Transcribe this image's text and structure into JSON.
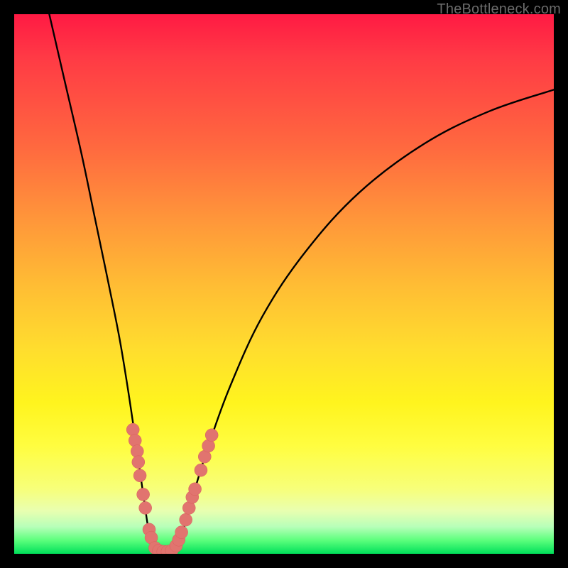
{
  "watermark": "TheBottleneck.com",
  "colors": {
    "background": "#000000",
    "marker_fill": "#e1746f",
    "marker_stroke": "#d85f5a",
    "curve": "#000000"
  },
  "chart_data": {
    "type": "line",
    "title": "",
    "xlabel": "",
    "ylabel": "",
    "xlim": [
      0,
      100
    ],
    "ylim": [
      0,
      100
    ],
    "grid": false,
    "legend": false,
    "curve_left": {
      "description": "left branch of V-shaped bottleneck curve",
      "points": [
        {
          "x": 6.5,
          "y": 100
        },
        {
          "x": 9.5,
          "y": 87
        },
        {
          "x": 12.5,
          "y": 74
        },
        {
          "x": 15,
          "y": 62
        },
        {
          "x": 17.5,
          "y": 50
        },
        {
          "x": 19.5,
          "y": 40
        },
        {
          "x": 21,
          "y": 31
        },
        {
          "x": 22.2,
          "y": 23
        },
        {
          "x": 23.2,
          "y": 16
        },
        {
          "x": 24.2,
          "y": 9
        },
        {
          "x": 25,
          "y": 4
        },
        {
          "x": 26,
          "y": 1.2
        },
        {
          "x": 27,
          "y": 0.4
        }
      ]
    },
    "curve_right": {
      "description": "right branch of V-shaped bottleneck curve",
      "points": [
        {
          "x": 29,
          "y": 0.4
        },
        {
          "x": 30,
          "y": 1.5
        },
        {
          "x": 31.5,
          "y": 5
        },
        {
          "x": 33.5,
          "y": 12
        },
        {
          "x": 36,
          "y": 20
        },
        {
          "x": 40,
          "y": 31
        },
        {
          "x": 46,
          "y": 44
        },
        {
          "x": 54,
          "y": 56
        },
        {
          "x": 64,
          "y": 67
        },
        {
          "x": 76,
          "y": 76
        },
        {
          "x": 88,
          "y": 82
        },
        {
          "x": 100,
          "y": 86
        }
      ]
    },
    "curve_bottom": {
      "description": "flat bottom of V curve",
      "points": [
        {
          "x": 27,
          "y": 0.4
        },
        {
          "x": 29,
          "y": 0.4
        }
      ]
    },
    "markers_left": {
      "description": "pink cluster markers on left branch",
      "points": [
        {
          "x": 22.0,
          "y": 23.0
        },
        {
          "x": 22.4,
          "y": 21.0
        },
        {
          "x": 22.8,
          "y": 19.0
        },
        {
          "x": 23.0,
          "y": 17.0
        },
        {
          "x": 23.3,
          "y": 14.5
        },
        {
          "x": 23.9,
          "y": 11.0
        },
        {
          "x": 24.3,
          "y": 8.5
        },
        {
          "x": 25.0,
          "y": 4.5
        },
        {
          "x": 25.4,
          "y": 3.0
        },
        {
          "x": 26.1,
          "y": 1.1
        },
        {
          "x": 26.8,
          "y": 0.6
        },
        {
          "x": 27.6,
          "y": 0.4
        }
      ]
    },
    "markers_right": {
      "description": "pink cluster markers on right branch",
      "points": [
        {
          "x": 28.4,
          "y": 0.4
        },
        {
          "x": 29.2,
          "y": 0.6
        },
        {
          "x": 30.0,
          "y": 1.5
        },
        {
          "x": 30.5,
          "y": 2.6
        },
        {
          "x": 31.0,
          "y": 4.0
        },
        {
          "x": 31.8,
          "y": 6.3
        },
        {
          "x": 32.4,
          "y": 8.5
        },
        {
          "x": 33.0,
          "y": 10.5
        },
        {
          "x": 33.5,
          "y": 12.0
        },
        {
          "x": 34.6,
          "y": 15.5
        },
        {
          "x": 35.3,
          "y": 18.0
        },
        {
          "x": 36.0,
          "y": 20.0
        },
        {
          "x": 36.6,
          "y": 22.0
        }
      ]
    }
  }
}
